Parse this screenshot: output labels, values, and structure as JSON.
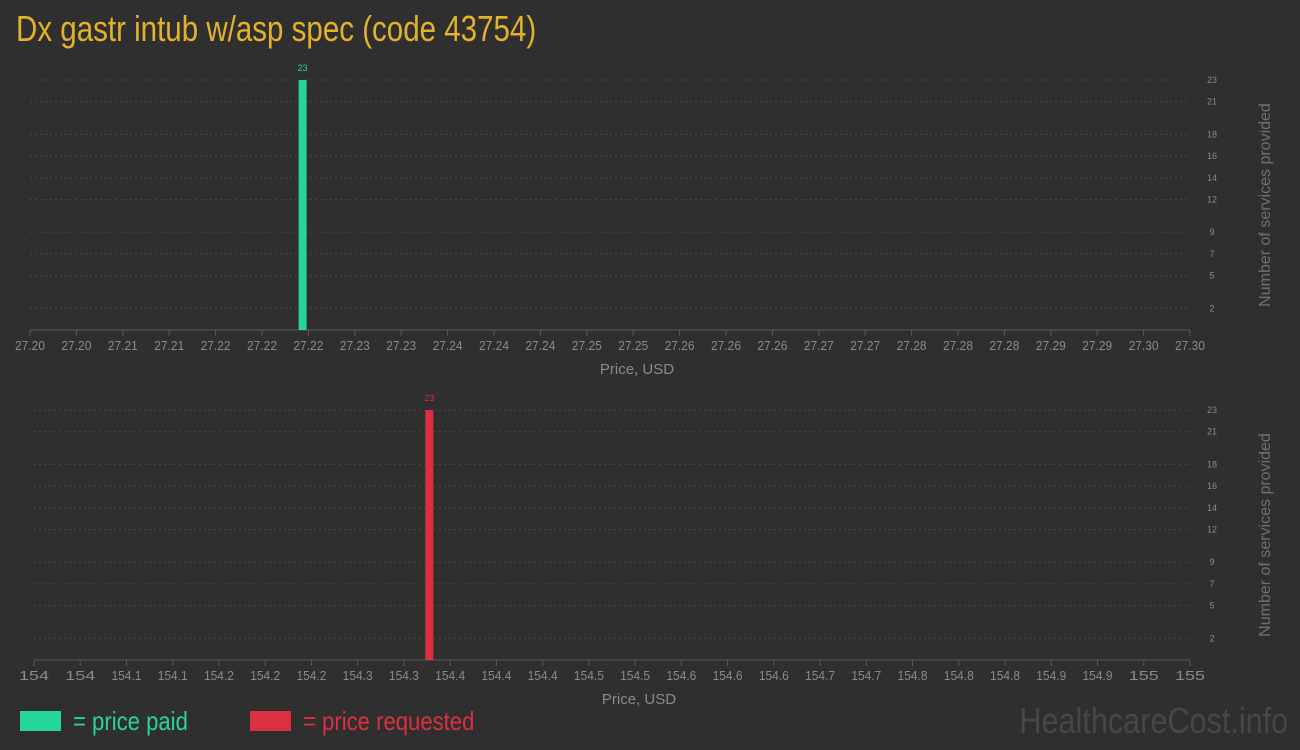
{
  "title": "Dx gastr intub w/asp spec (code 43754)",
  "legend": {
    "paid_label": "= price paid",
    "requested_label": "= price requested"
  },
  "watermark": "HealthcareCost.info",
  "colors": {
    "background": "#2f2f2f",
    "title": "#e3b12a",
    "paid": "#25d59a",
    "requested": "#dc2f3f",
    "axis_text": "#8a8a8a",
    "grid": "#4a4a4a"
  },
  "chart_data": [
    {
      "type": "bar",
      "name": "price paid",
      "xlabel": "Price, USD",
      "ylabel": "Number of services provided",
      "x_ticks": [
        "27.20",
        "27.20",
        "27.21",
        "27.21",
        "27.22",
        "27.22",
        "27.22",
        "27.23",
        "27.23",
        "27.24",
        "27.24",
        "27.24",
        "27.25",
        "27.25",
        "27.26",
        "27.26",
        "27.26",
        "27.27",
        "27.27",
        "27.28",
        "27.28",
        "27.28",
        "27.29",
        "27.29",
        "27.30",
        "27.30"
      ],
      "xlim": [
        27.2,
        27.3
      ],
      "y_ticks": [
        2,
        5,
        7,
        9,
        12,
        14,
        16,
        18,
        21,
        23
      ],
      "ylim": [
        0,
        23
      ],
      "grid": true,
      "bars": [
        {
          "x": 27.2235,
          "value": 23,
          "label": "23"
        }
      ],
      "color": "#25d59a"
    },
    {
      "type": "bar",
      "name": "price requested",
      "xlabel": "Price, USD",
      "ylabel": "Number of services provided",
      "x_ticks": [
        "154",
        "154",
        "154.1",
        "154.1",
        "154.2",
        "154.2",
        "154.2",
        "154.3",
        "154.3",
        "154.4",
        "154.4",
        "154.4",
        "154.5",
        "154.5",
        "154.6",
        "154.6",
        "154.6",
        "154.7",
        "154.7",
        "154.8",
        "154.8",
        "154.8",
        "154.9",
        "154.9",
        "155",
        "155"
      ],
      "xlim": [
        154,
        155
      ],
      "y_ticks": [
        2,
        5,
        7,
        9,
        12,
        14,
        16,
        18,
        21,
        23
      ],
      "ylim": [
        0,
        23
      ],
      "grid": true,
      "bars": [
        {
          "x": 154.342,
          "value": 23,
          "label": "23"
        }
      ],
      "color": "#dc2f3f"
    }
  ]
}
